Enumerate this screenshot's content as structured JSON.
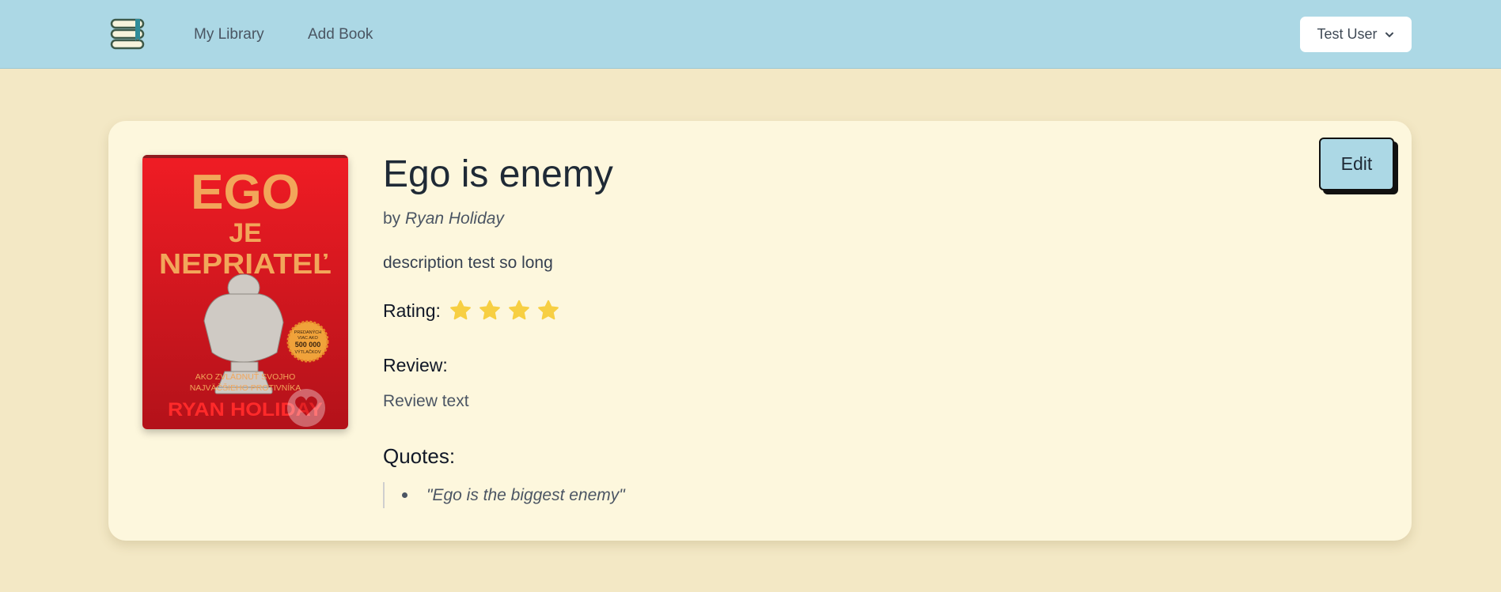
{
  "navbar": {
    "logo": {
      "icon": "books-logo-icon"
    },
    "links": [
      {
        "label": "My Library"
      },
      {
        "label": "Add Book"
      }
    ],
    "user_menu": {
      "label": "Test User",
      "icon": "chevron-down-icon"
    }
  },
  "book": {
    "title": "Ego is enemy",
    "by_prefix": "by",
    "author": "Ryan Holiday",
    "description": "description test so long",
    "rating_label": "Rating:",
    "rating": 4,
    "review_label": "Review:",
    "review_text": "Review text",
    "quotes_label": "Quotes:",
    "quotes": [
      "\"Ego is the biggest enemy\""
    ],
    "edit_label": "Edit",
    "cover": {
      "line1": "EGO",
      "line2": "JE",
      "line3": "NEPRIATEĽ",
      "subtitle_line1": "AKO ZVLÁDNUŤ SVOJHO",
      "subtitle_line2": "NAJVÄČŠIEHO PROTIVNÍKA",
      "author": "RYAN HOLIDAY",
      "badge_line1": "PREDANÝCH",
      "badge_line2": "VIAC AKO",
      "badge_line3": "500 000",
      "badge_line4": "VÝTLAČKOV"
    }
  },
  "colors": {
    "page_bg": "#f3e8c5",
    "navbar_bg": "#acd8e5",
    "card_bg": "#fdf7dd",
    "star": "#f7cf43",
    "cover_red": "#e41e26",
    "cover_orange": "#f2a65a"
  }
}
